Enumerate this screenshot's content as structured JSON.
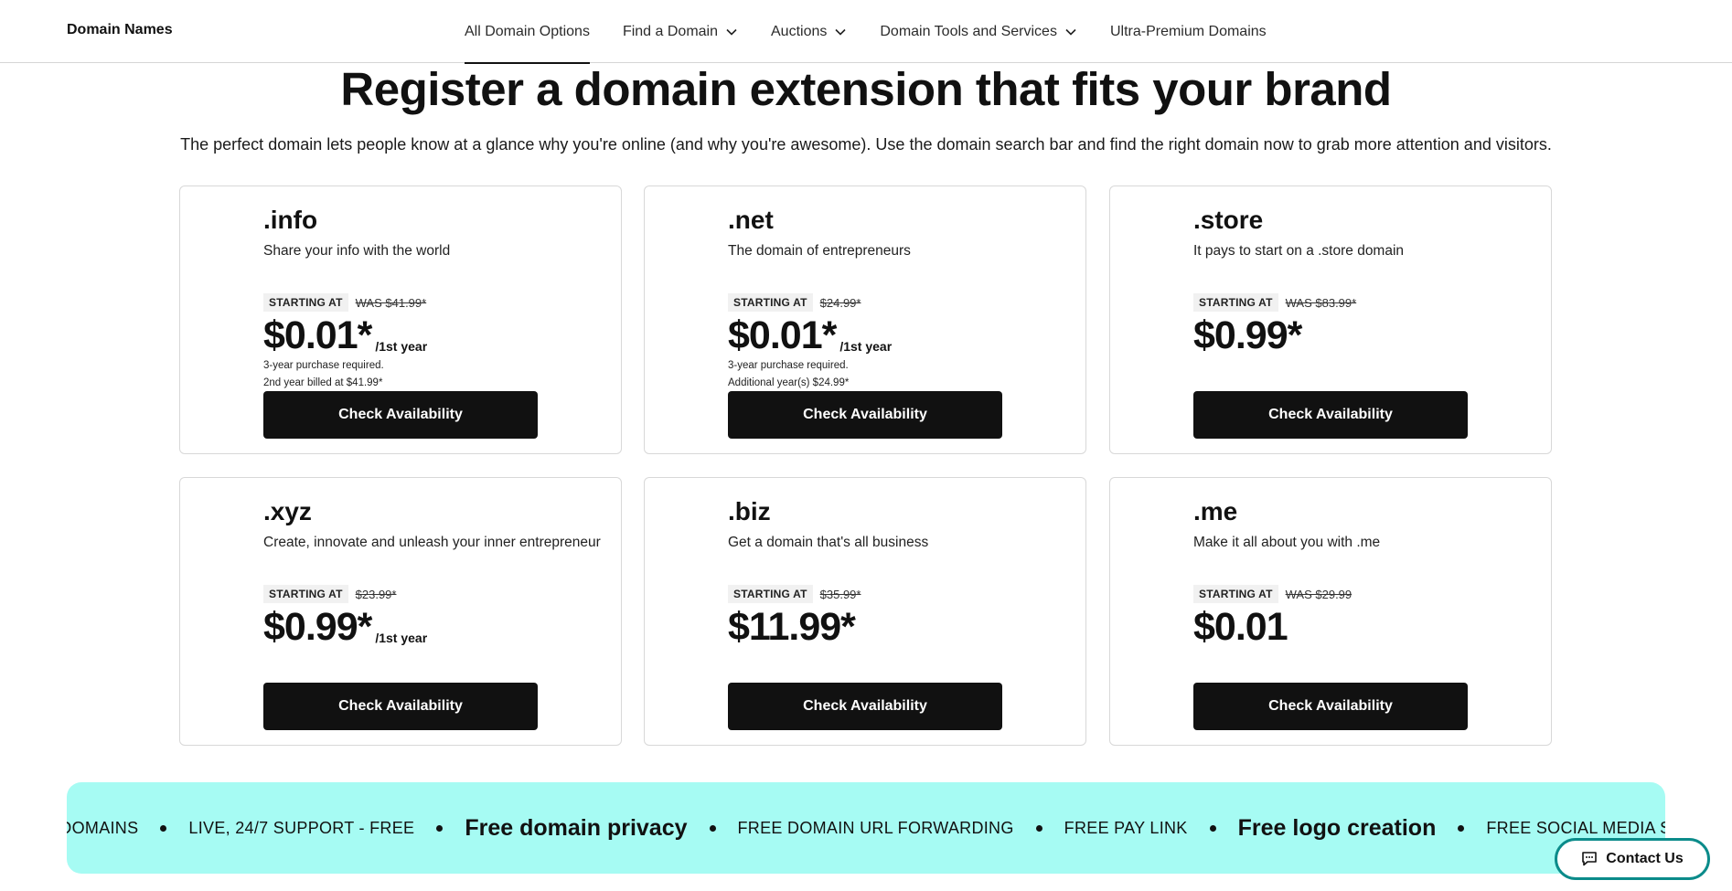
{
  "nav": {
    "brand": "Domain Names",
    "items": [
      {
        "label": "All Domain Options",
        "has_menu": false,
        "active": true
      },
      {
        "label": "Find a Domain",
        "has_menu": true,
        "active": false
      },
      {
        "label": "Auctions",
        "has_menu": true,
        "active": false
      },
      {
        "label": "Domain Tools and Services",
        "has_menu": true,
        "active": false
      },
      {
        "label": "Ultra-Premium Domains",
        "has_menu": false,
        "active": false
      }
    ]
  },
  "hero": {
    "title": "Register a domain extension that fits your brand",
    "description": "The perfect domain lets people know at a glance why you're online (and why you're awesome). Use the domain search bar and find the right domain now to grab more attention and visitors."
  },
  "cards": [
    {
      "tld": ".info",
      "tagline": "Share your info with the world",
      "starting_label": "STARTING AT",
      "was": "WAS $41.99*",
      "price": "$0.01*",
      "period": "/1st year",
      "fine1": "3-year purchase required.",
      "fine2": "2nd year billed at $41.99*",
      "button": "Check Availability"
    },
    {
      "tld": ".net",
      "tagline": "The domain of entrepreneurs",
      "starting_label": "STARTING AT",
      "was": "$24.99*",
      "price": "$0.01*",
      "period": "/1st year",
      "fine1": "3-year purchase required.",
      "fine2": "Additional year(s) $24.99*",
      "button": "Check Availability"
    },
    {
      "tld": ".store",
      "tagline": "It pays to start on a .store domain",
      "starting_label": "STARTING AT",
      "was": "WAS $83.99*",
      "price": "$0.99*",
      "period": "",
      "fine1": "",
      "fine2": "",
      "button": "Check Availability"
    },
    {
      "tld": ".xyz",
      "tagline": "Create, innovate and unleash your inner entrepreneur",
      "starting_label": "STARTING AT",
      "was": "$23.99*",
      "price": "$0.99*",
      "period": "/1st year",
      "fine1": "",
      "fine2": "",
      "button": "Check Availability"
    },
    {
      "tld": ".biz",
      "tagline": "Get a domain that's all business",
      "starting_label": "STARTING AT",
      "was": "$35.99*",
      "price": "$11.99*",
      "period": "",
      "fine1": "",
      "fine2": "",
      "button": "Check Availability"
    },
    {
      "tld": ".me",
      "tagline": "Make it all about you with .me",
      "starting_label": "STARTING AT",
      "was": "WAS $29.99",
      "price": "$0.01",
      "period": "",
      "fine1": "",
      "fine2": "",
      "button": "Check Availability"
    }
  ],
  "ticker": {
    "items": [
      {
        "text": "BDOMAINS",
        "big": false
      },
      {
        "text": "LIVE, 24/7 SUPPORT - FREE",
        "big": false
      },
      {
        "text": "Free domain privacy",
        "big": true
      },
      {
        "text": "FREE DOMAIN URL FORWARDING",
        "big": false
      },
      {
        "text": "FREE PAY LINK",
        "big": false
      },
      {
        "text": "Free logo creation",
        "big": true
      },
      {
        "text": "FREE SOCIAL MEDIA SUBDOMAINS",
        "big": false
      }
    ]
  },
  "contact": {
    "label": "Contact Us",
    "icon": "chat-icon"
  },
  "colors": {
    "ticker_bg": "#a6fbf3",
    "button_bg": "#111111",
    "contact_border": "#0b8b8a"
  }
}
